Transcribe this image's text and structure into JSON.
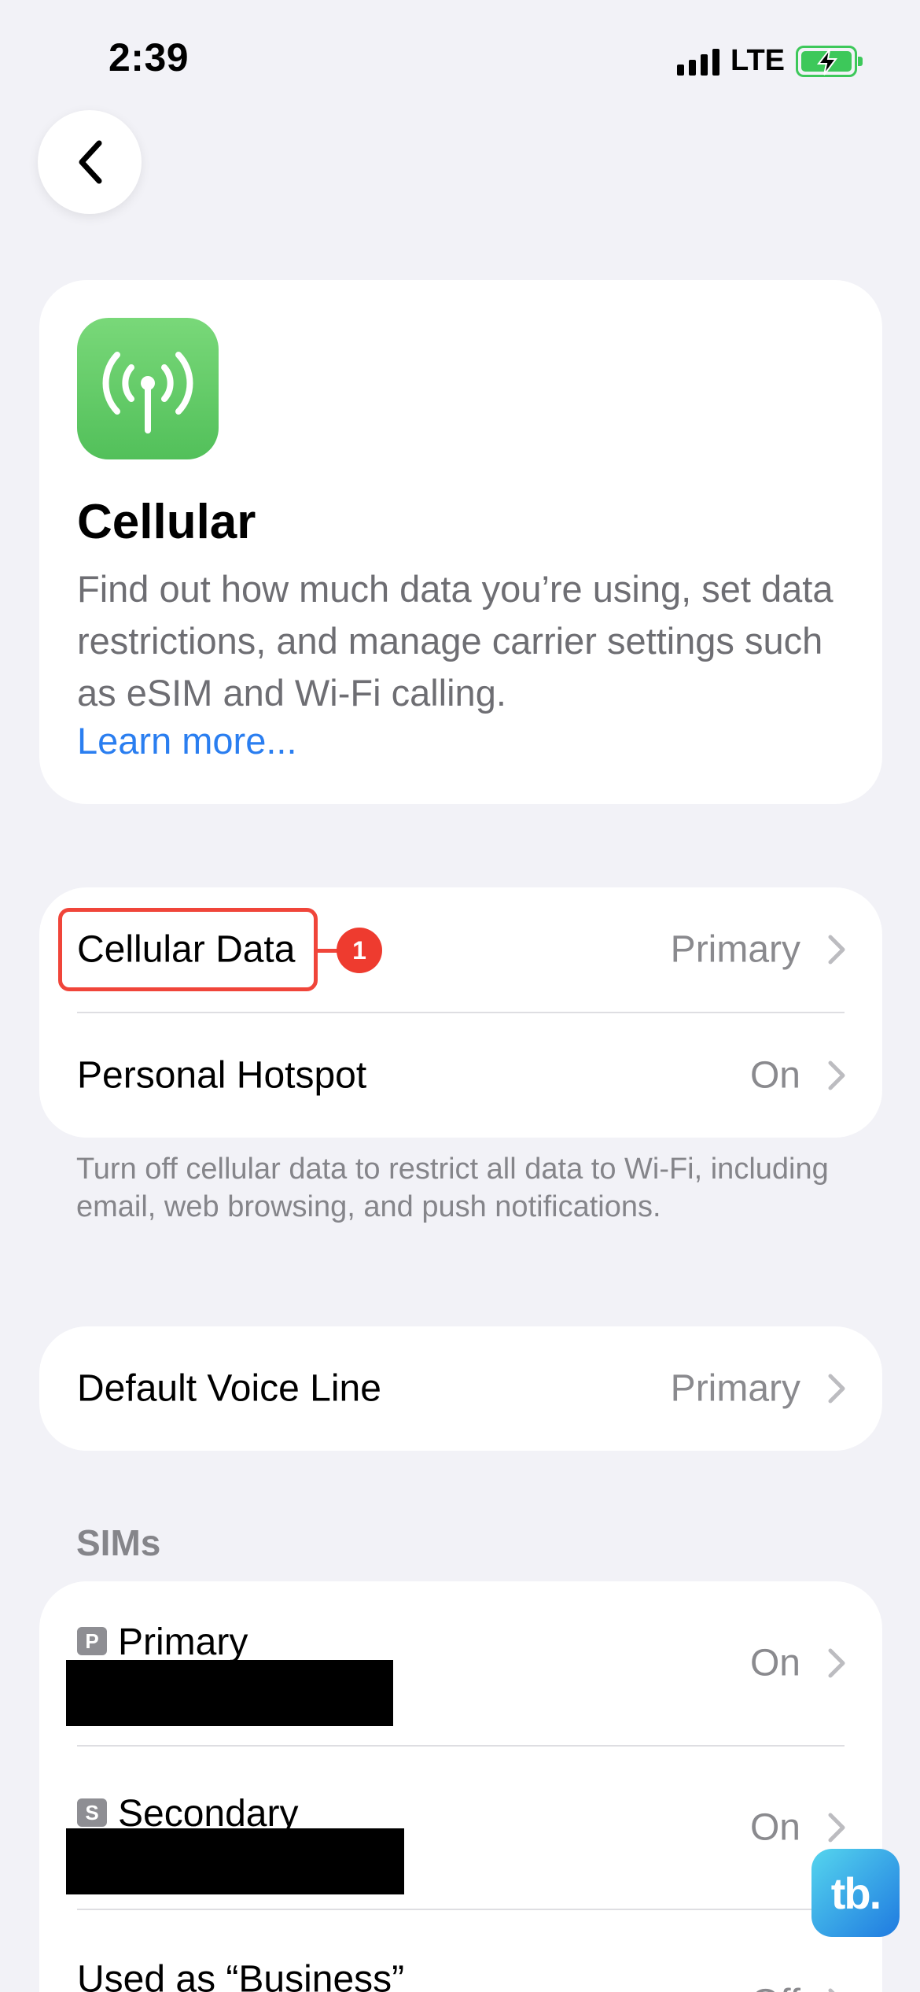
{
  "status_bar": {
    "time": "2:39",
    "network": "LTE",
    "icons": [
      "signal-bars-icon",
      "battery-charging-icon"
    ],
    "battery_color": "#3dc85a"
  },
  "navigation": {
    "back_icon": "chevron-left-icon"
  },
  "hero": {
    "icon": "antenna-icon",
    "icon_color": "#52c05a",
    "title": "Cellular",
    "description": "Find out how much data you’re using, set data restrictions, and manage carrier settings such as eSIM and Wi-Fi calling.",
    "link": "Learn more..."
  },
  "data_group": {
    "rows": [
      {
        "label": "Cellular Data",
        "value": "Primary"
      },
      {
        "label": "Personal Hotspot",
        "value": "On"
      }
    ],
    "highlight_step": "1",
    "highlight_color": "#f0453a",
    "footnote": "Turn off cellular data to restrict all data to Wi-Fi, including email, web browsing, and push notifications."
  },
  "voice_group": {
    "rows": [
      {
        "label": "Default Voice Line",
        "value": "Primary"
      }
    ]
  },
  "sims": {
    "header": "SIMs",
    "rows": [
      {
        "badge": "P",
        "name": "Primary",
        "value": "On"
      },
      {
        "badge": "S",
        "name": "Secondary",
        "value": "On"
      },
      {
        "label": "Used as “Business”",
        "value": "Off"
      }
    ]
  },
  "watermark": {
    "text": "tb."
  },
  "colors": {
    "background": "#f2f2f7",
    "link": "#2a7ef0",
    "secondary_text": "#8a8a8e"
  }
}
